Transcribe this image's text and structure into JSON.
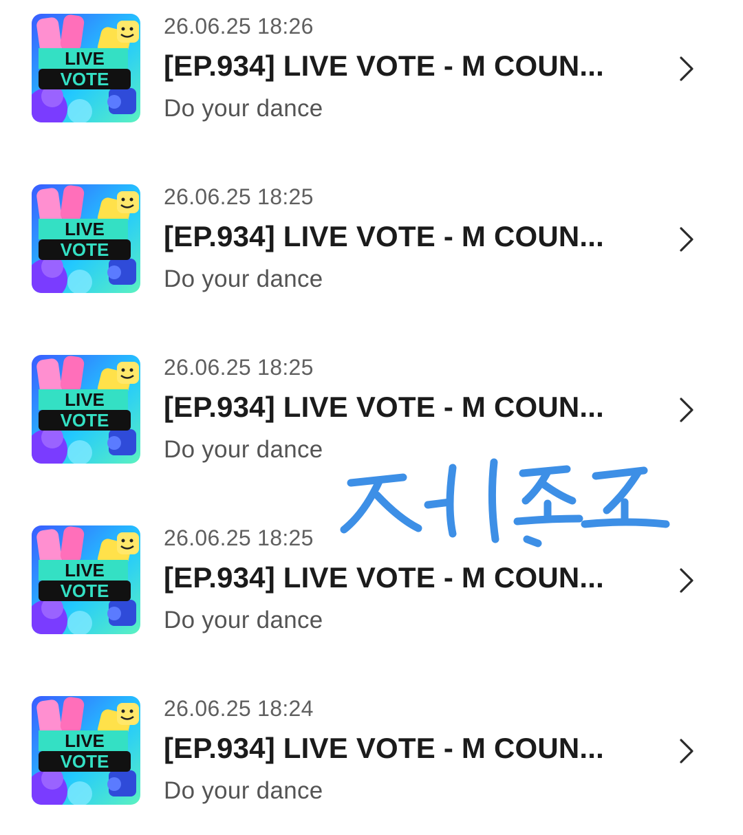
{
  "list": {
    "items": [
      {
        "date": "26.06.25 18:26",
        "title": "[EP.934] LIVE VOTE - M COUN...",
        "subtitle": "Do your dance",
        "thumb_line1": "LIVE",
        "thumb_line2": "VOTE"
      },
      {
        "date": "26.06.25 18:25",
        "title": "[EP.934] LIVE VOTE - M COUN...",
        "subtitle": "Do your dance",
        "thumb_line1": "LIVE",
        "thumb_line2": "VOTE"
      },
      {
        "date": "26.06.25 18:25",
        "title": "[EP.934] LIVE VOTE - M COUN...",
        "subtitle": "Do your dance",
        "thumb_line1": "LIVE",
        "thumb_line2": "VOTE"
      },
      {
        "date": "26.06.25 18:25",
        "title": "[EP.934] LIVE VOTE - M COUN...",
        "subtitle": "Do your dance",
        "thumb_line1": "LIVE",
        "thumb_line2": "VOTE"
      },
      {
        "date": "26.06.25 18:24",
        "title": "[EP.934] LIVE VOTE - M COUN...",
        "subtitle": "Do your dance",
        "thumb_line1": "LIVE",
        "thumb_line2": "VOTE"
      }
    ],
    "chevron_icon": "chevron-right-icon"
  },
  "annotation": {
    "text": "저리꼬",
    "color": "#3d8fe6"
  },
  "colors": {
    "thumb_gradient_top": "#2f7bff",
    "thumb_gradient_bottom": "#3ee6c8",
    "thumb_label_band": "#34e0c4",
    "thumb_label_black": "#111111",
    "thumb_pink": "#ff7ac6",
    "thumb_yellow": "#ffe14a",
    "thumb_purple": "#7a3cff"
  }
}
